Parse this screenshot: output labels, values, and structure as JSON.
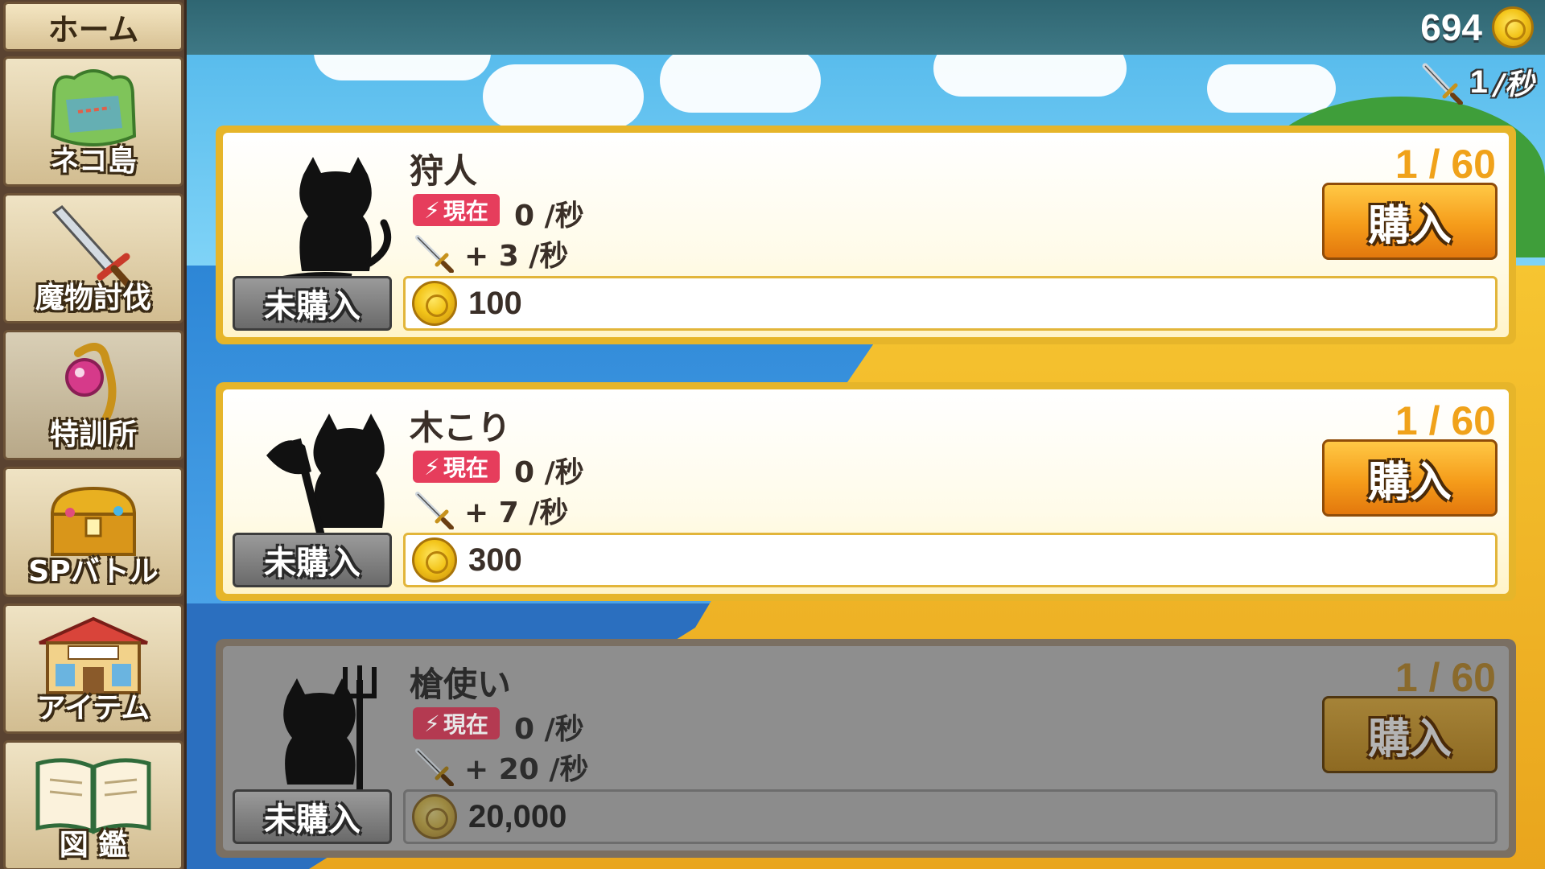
{
  "sidebar": {
    "home": "ホーム",
    "items": [
      {
        "label": "ネコ島",
        "icon": "island-map-icon"
      },
      {
        "label": "魔物討伐",
        "icon": "sword-icon"
      },
      {
        "label": "特訓所",
        "icon": "magic-orb-icon"
      },
      {
        "label": "SPバトル",
        "icon": "treasure-chest-icon"
      },
      {
        "label": "アイテム",
        "icon": "shop-icon"
      },
      {
        "label": "図 鑑",
        "icon": "book-icon"
      }
    ]
  },
  "header": {
    "coins": "694",
    "rate_value": "1",
    "rate_unit": "/秒"
  },
  "units": [
    {
      "name": "狩人",
      "now_label": "現在",
      "current": "0 /秒",
      "gain": "+ 3 /秒",
      "level": "1 / 60",
      "buy_label": "購入",
      "status": "未購入",
      "price": "100",
      "locked": false,
      "weapon": "none"
    },
    {
      "name": "木こり",
      "now_label": "現在",
      "current": "0 /秒",
      "gain": "+ 7 /秒",
      "level": "1 / 60",
      "buy_label": "購入",
      "status": "未購入",
      "price": "300",
      "locked": false,
      "weapon": "axe"
    },
    {
      "name": "槍使い",
      "now_label": "現在",
      "current": "0 /秒",
      "gain": "+ 20 /秒",
      "level": "1 / 60",
      "buy_label": "購入",
      "status": "未購入",
      "price": "20,000",
      "locked": true,
      "weapon": "trident"
    }
  ],
  "colors": {
    "accent_orange": "#f59c1a",
    "card_border": "#e6b52a",
    "badge_red": "#e63d5c",
    "level_orange": "#f0a21a"
  }
}
